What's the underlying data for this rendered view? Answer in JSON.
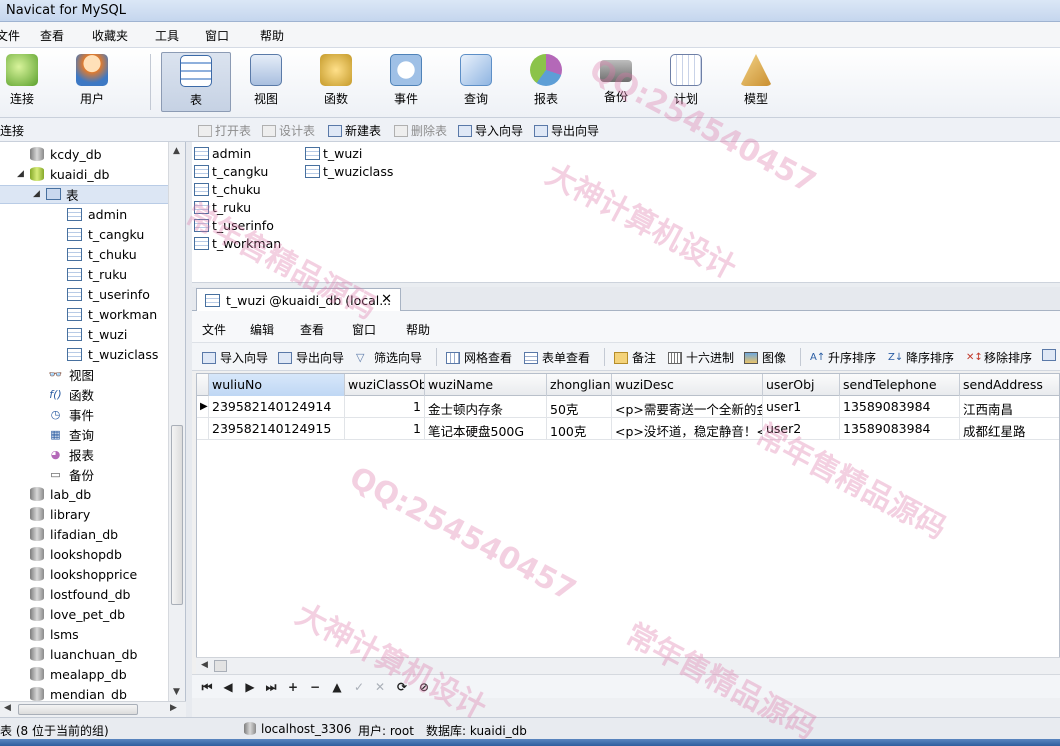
{
  "window": {
    "title": "Navicat for MySQL"
  },
  "menubar": [
    "文件",
    "查看",
    "收藏夹",
    "工具",
    "窗口",
    "帮助"
  ],
  "toolbar": [
    {
      "label": "连接",
      "icon": "connect-icon",
      "color": "#5aa02c"
    },
    {
      "label": "用户",
      "icon": "user-icon",
      "color": "#e07b2e"
    },
    {
      "label": "表",
      "icon": "table-icon",
      "color": "#4f7fbf"
    },
    {
      "label": "视图",
      "icon": "view-icon",
      "color": "#6f8fb9"
    },
    {
      "label": "函数",
      "icon": "function-icon",
      "color": "#c59a2a"
    },
    {
      "label": "事件",
      "icon": "event-icon",
      "color": "#4f82b8"
    },
    {
      "label": "查询",
      "icon": "query-icon",
      "color": "#5d8fc7"
    },
    {
      "label": "报表",
      "icon": "report-icon",
      "color": "#b468b8"
    },
    {
      "label": "备份",
      "icon": "backup-icon",
      "color": "#6e6e6e"
    },
    {
      "label": "计划",
      "icon": "schedule-icon",
      "color": "#6e7fa6"
    },
    {
      "label": "模型",
      "icon": "model-icon",
      "color": "#c98e2f"
    }
  ],
  "connection_header": "连接",
  "object_toolbar": [
    {
      "label": "打开表",
      "enabled": false
    },
    {
      "label": "设计表",
      "enabled": false
    },
    {
      "label": "新建表",
      "enabled": true
    },
    {
      "label": "删除表",
      "enabled": false
    },
    {
      "label": "导入向导",
      "enabled": true
    },
    {
      "label": "导出向导",
      "enabled": true
    }
  ],
  "tree": {
    "db_before": [
      "kcdy_db"
    ],
    "open_db": "kuaidi_db",
    "tables_folder": "表",
    "tables": [
      "admin",
      "t_cangku",
      "t_chuku",
      "t_ruku",
      "t_userinfo",
      "t_workman",
      "t_wuzi",
      "t_wuziclass"
    ],
    "other_folders": [
      "视图",
      "函数",
      "事件",
      "查询",
      "报表",
      "备份"
    ],
    "db_after": [
      "lab_db",
      "library",
      "lifadian_db",
      "lookshopdb",
      "lookshopprice",
      "lostfound_db",
      "love_pet_db",
      "lsms",
      "luanchuan_db",
      "mealapp_db",
      "mendian_db"
    ]
  },
  "object_list": {
    "col1": [
      "admin",
      "t_cangku",
      "t_chuku",
      "t_ruku",
      "t_userinfo",
      "t_workman"
    ],
    "col2": [
      "t_wuzi",
      "t_wuziclass"
    ]
  },
  "tab": {
    "label": "t_wuzi @kuaidi_db (local...",
    "close": "✕"
  },
  "inner_menu": [
    "文件",
    "编辑",
    "查看",
    "窗口",
    "帮助"
  ],
  "inner_toolbar": [
    "导入向导",
    "导出向导",
    "筛选向导",
    "网格查看",
    "表单查看",
    "备注",
    "十六进制",
    "图像",
    "升序排序",
    "降序排序",
    "移除排序"
  ],
  "grid": {
    "columns": [
      "wuliuNo",
      "wuziClassObj",
      "wuziName",
      "zhongliang",
      "wuziDesc",
      "userObj",
      "sendTelephone",
      "sendAddress"
    ],
    "rows": [
      [
        "239582140124914",
        "1",
        "金士顿内存条",
        "50克",
        "<p>需要寄送一个全新的金",
        "user1",
        "13589083984",
        "江西南昌"
      ],
      [
        "239582140124915",
        "1",
        "笔记本硬盘500G",
        "100克",
        "<p>没坏道，稳定静音！</",
        "user2",
        "13589083984",
        "成都红星路"
      ]
    ],
    "current_row_marker": "▶"
  },
  "navbar": [
    "⏮",
    "◀",
    "▶",
    "⏭",
    "+",
    "−",
    "▲",
    "✓",
    "✕",
    "⟳",
    "⊘"
  ],
  "status": {
    "left": "表 (8 位于当前的组)",
    "host": "localhost_3306",
    "user": "用户: root",
    "database": "数据库: kuaidi_db"
  },
  "watermarks": [
    "QQ:254540457",
    "大神计算机设计",
    "常年售精品源码"
  ]
}
